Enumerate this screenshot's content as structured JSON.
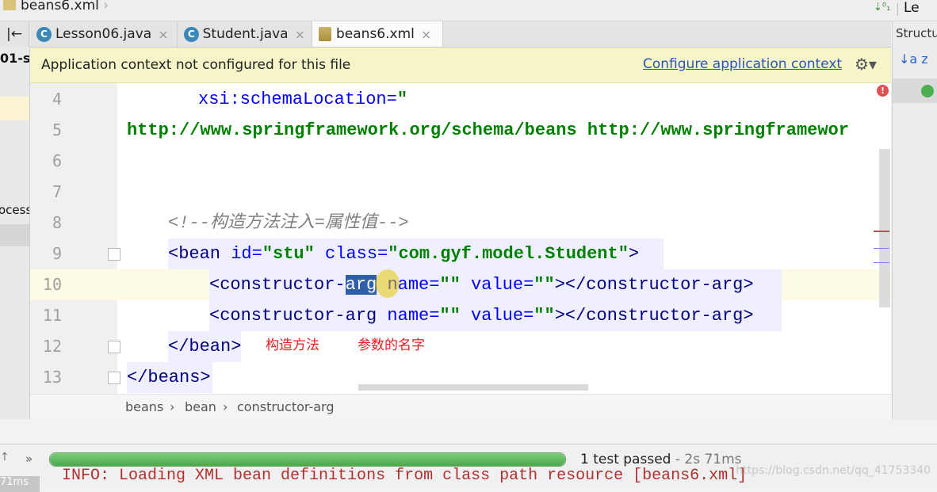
{
  "window": {
    "file": "beans6.xml",
    "right_fragment": "Le"
  },
  "tabs": [
    {
      "label": "Lesson06.java",
      "active": false
    },
    {
      "label": "Student.java",
      "active": false
    },
    {
      "label": "beans6.xml",
      "active": true
    }
  ],
  "left_panel": {
    "project_fragment": "01-s",
    "process_fragment": "ocess"
  },
  "banner": {
    "message": "Application context not configured for this file",
    "link": "Configure application context",
    "gear_glyph": "⚙▾"
  },
  "editor": {
    "line_numbers": [
      "4",
      "5",
      "6",
      "7",
      "8",
      "9",
      "10",
      "11",
      "12",
      "13"
    ],
    "lines": {
      "l4_attr": "xsi:schemaLocation=",
      "l4_q": "\"",
      "l5": "http://www.springframework.org/schema/beans http://www.springframewor",
      "l8": "<!--构造方法注入=属性值-->",
      "l9_open": "<bean ",
      "l9_id_attr": "id=",
      "l9_id_val": "\"stu\"",
      "l9_class_attr": " class=",
      "l9_class_val": "\"com.gyf.model.Student\"",
      "l9_close": ">",
      "ca_open": "<constructor-",
      "ca_sel": "arg",
      "ca_name_attr": " name=",
      "ca_name_val": "\"\"",
      "ca_value_attr": " value=",
      "ca_value_val": "\"\"",
      "ca_end": "></constructor-arg>",
      "l11_open": "<constructor-arg",
      "l12": "</bean>",
      "l13": "</beans>"
    },
    "annotations": {
      "constructor": "构造方法",
      "param_name": "参数的名字"
    },
    "error_mark": "!"
  },
  "breadcrumbs": [
    "beans",
    "bean",
    "constructor-arg"
  ],
  "breadcrumb_sep": "›",
  "structure": {
    "title": "Structu",
    "sort_glyph": "↓a z"
  },
  "run": {
    "status": "1 test passed",
    "time": " - 2s 71ms",
    "progress": 1.0,
    "console": "INFO: Loading XML bean definitions from class path resource [beans6.xml]",
    "elapsed": "71ms",
    "chevron": "»"
  },
  "watermark": "https://blog.csdn.net/qq_41753340",
  "colors": {
    "tag": "#000080",
    "attribute": "#0000ff",
    "value": "#008000",
    "comment": "#808080",
    "annotation": "#e02020",
    "link": "#2a55b5",
    "banner_bg": "#f6f5c9",
    "progress_green": "#4ca64c"
  }
}
